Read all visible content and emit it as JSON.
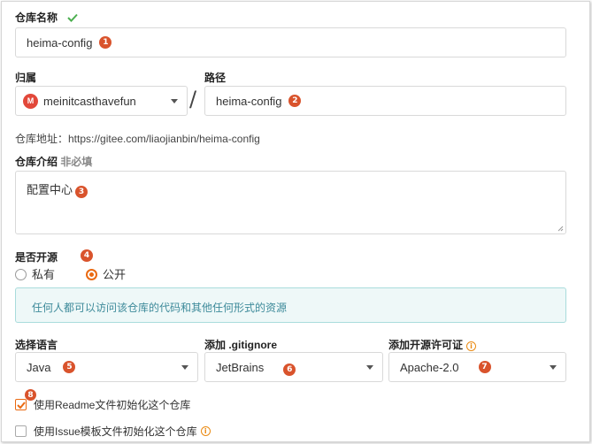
{
  "repo_name": {
    "label": "仓库名称",
    "value": "heima-config",
    "badge": "1"
  },
  "owner": {
    "label": "归属",
    "avatar_letter": "M",
    "value": "meinitcasthavefun"
  },
  "separator": "/",
  "path": {
    "label": "路径",
    "value": "heima-config",
    "badge": "2"
  },
  "repo_address": "仓库地址：https://gitee.com/liaojianbin/heima-config",
  "description": {
    "label": "仓库介绍",
    "optional": "非必填",
    "value": "配置中心",
    "badge": "3"
  },
  "visibility": {
    "label": "是否开源",
    "badge": "4",
    "options": [
      "私有",
      "公开"
    ],
    "selected": "公开",
    "notice": "任何人都可以访问该仓库的代码和其他任何形式的资源"
  },
  "language": {
    "label": "选择语言",
    "value": "Java",
    "badge": "5"
  },
  "gitignore": {
    "label": "添加 .gitignore",
    "value": "JetBrains",
    "badge": "6"
  },
  "license": {
    "label": "添加开源许可证",
    "value": "Apache-2.0",
    "badge": "7"
  },
  "init_readme": {
    "label": "使用Readme文件初始化这个仓库",
    "checked": true,
    "badge": "8"
  },
  "init_issue": {
    "label": "使用Issue模板文件初始化这个仓库",
    "checked": false
  },
  "colors": {
    "accent": "#ea6a12",
    "badge": "#d9532c",
    "valid": "#4caf50",
    "notice_bg": "#eef8f8",
    "notice_border": "#a9dcdc"
  }
}
